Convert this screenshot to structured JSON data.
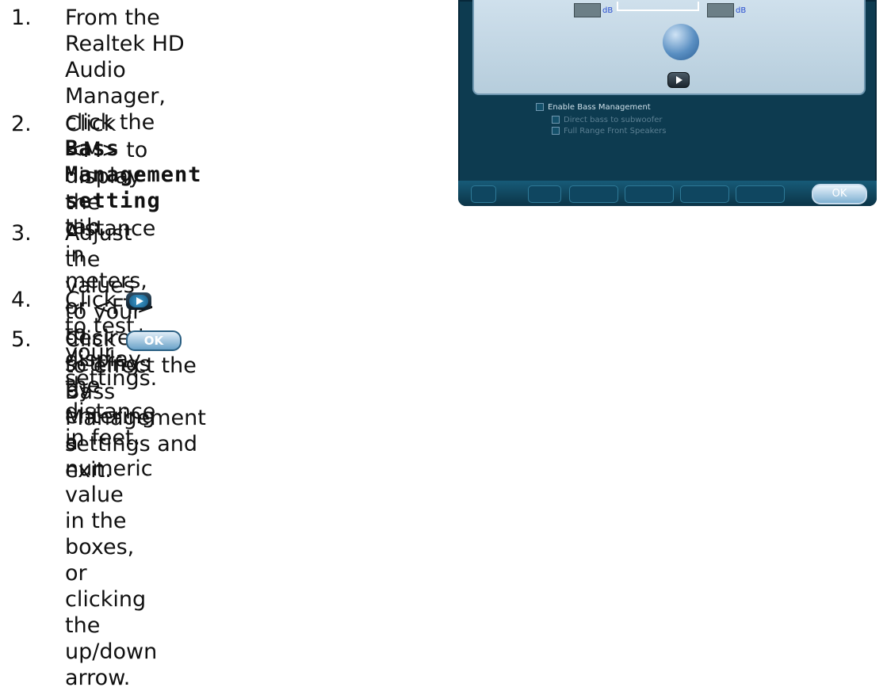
{
  "steps": [
    {
      "num": "1.",
      "lines": [
        "From the Realtek HD Audio",
        "Manager, click the ",
        "Bass",
        "Management setting",
        " tab."
      ]
    },
    {
      "num": "2.",
      "lines": [
        "Click <M> to display the",
        "distance in meters, or <FT> to",
        "display the distance in feet."
      ]
    },
    {
      "num": "3.",
      "lines": [
        "Adjust the values to your desired settings by entering a numeric value",
        "in the boxes, or clicking the up/down arrow."
      ]
    },
    {
      "num": "4.",
      "pre": "Click ",
      "post": " to test your settings."
    },
    {
      "num": "5.",
      "pre": "Click ",
      "ok": "OK",
      "post": " to effect the Bass Management settings and exit."
    }
  ],
  "panel": {
    "db_left": "dB",
    "db_right": "dB",
    "enable_label": "Enable Bass Management",
    "sub_option_1": "Direct bass to subwoofer",
    "sub_option_2": "Full Range Front Speakers",
    "ok_label": "OK"
  }
}
